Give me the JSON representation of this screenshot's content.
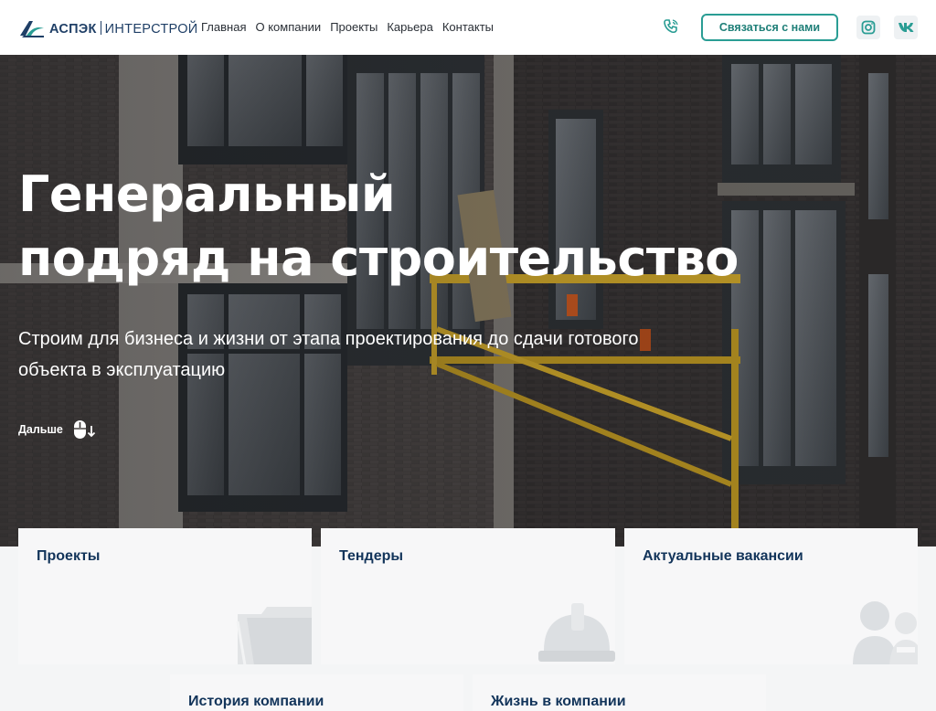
{
  "header": {
    "logo": {
      "brand": "АСПЭК",
      "sub": "ИНТЕРСТРОЙ"
    },
    "nav": [
      {
        "label": "Главная",
        "icon": null
      },
      {
        "label": "О компании",
        "icon": null
      },
      {
        "label": "Проекты",
        "icon": null
      },
      {
        "label": "Карьера",
        "icon": null
      },
      {
        "label": "Контакты",
        "icon": null
      }
    ],
    "phone_icon": "phone-icon",
    "contact_button": "Связаться с нами",
    "socials": [
      {
        "name": "instagram-icon"
      },
      {
        "name": "vk-icon"
      }
    ]
  },
  "hero": {
    "title_line1": "Генеральный",
    "title_line2": "подряд на строительство",
    "subtitle_line1": "Строим для бизнеса и жизни от этапа проектирования до сдачи готового",
    "subtitle_line2": "объекта в эксплуатацию",
    "more_label": "Дальше",
    "more_icon": "mouse-scroll-icon"
  },
  "cards": [
    {
      "title": "Проекты",
      "icon": "folder-icon"
    },
    {
      "title": "Тендеры",
      "icon": "hardhat-icon"
    },
    {
      "title": "Актуальные вакансии",
      "icon": "people-icon"
    },
    {
      "title": "История компании",
      "icon": null
    },
    {
      "title": "Жизнь в компании",
      "icon": null
    }
  ],
  "colors": {
    "brand_dark": "#12345a",
    "accent_teal": "#2a9d94",
    "header_bg": "#ffffff",
    "card_bg": "#f7f7f8"
  }
}
